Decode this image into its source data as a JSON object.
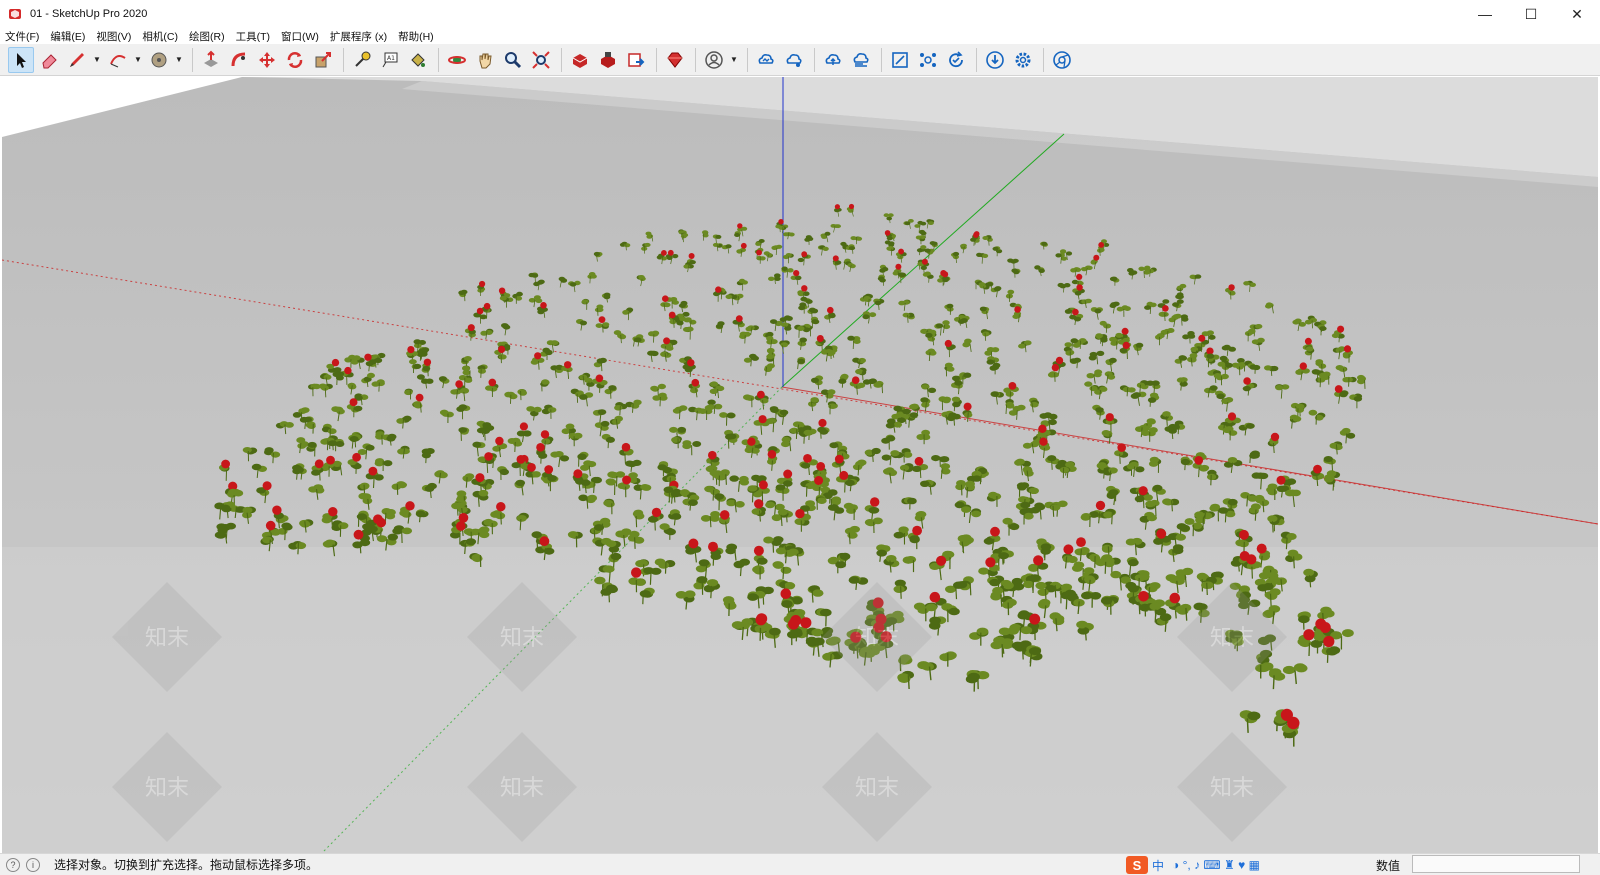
{
  "window": {
    "title": "01 - SketchUp Pro 2020",
    "controls": [
      "—",
      "☐",
      "✕"
    ]
  },
  "menu": [
    "文件(F)",
    "编辑(E)",
    "视图(V)",
    "相机(C)",
    "绘图(R)",
    "工具(T)",
    "窗口(W)",
    "扩展程序 (x)",
    "帮助(H)"
  ],
  "toolbar": {
    "tools": [
      {
        "name": "select-tool-icon",
        "active": true
      },
      {
        "name": "eraser-tool-icon"
      },
      {
        "name": "pencil-line-tool-icon",
        "dropdown": true
      },
      {
        "name": "arc-tool-icon",
        "dropdown": true
      },
      {
        "name": "shape-circle-tool-icon",
        "dropdown": true
      },
      {
        "name": "push-pull-tool-icon"
      },
      {
        "name": "follow-me-tool-icon"
      },
      {
        "name": "move-tool-icon"
      },
      {
        "name": "rotate-tool-icon"
      },
      {
        "name": "scale-tool-icon"
      },
      {
        "name": "tape-measure-tool-icon"
      },
      {
        "name": "text-tool-icon"
      },
      {
        "name": "paint-bucket-tool-icon"
      },
      {
        "name": "orbit-tool-icon"
      },
      {
        "name": "pan-tool-icon"
      },
      {
        "name": "zoom-tool-icon"
      },
      {
        "name": "zoom-extents-tool-icon"
      },
      {
        "name": "3d-warehouse-icon"
      },
      {
        "name": "extension-warehouse-icon"
      },
      {
        "name": "layout-send-icon"
      },
      {
        "name": "extension-manager-ruby-icon"
      },
      {
        "name": "account-user-icon",
        "dropdown": true
      },
      {
        "name": "trimble-connect-icon"
      },
      {
        "name": "cloud-share-icon"
      },
      {
        "name": "cloud-upload-icon"
      },
      {
        "name": "cloud-sync-icon"
      },
      {
        "name": "frame-icon"
      },
      {
        "name": "network-icon"
      },
      {
        "name": "refresh-check-icon"
      },
      {
        "name": "download-icon"
      },
      {
        "name": "settings-gear-icon"
      },
      {
        "name": "chrome-browser-icon"
      }
    ]
  },
  "viewport": {
    "watermark": "知末",
    "colors": {
      "ground_near": "#c9c9c9",
      "ground_far": "#bfbfbf",
      "sky": "#ffffff",
      "axis_red": "#cc2222",
      "axis_green": "#22aa22",
      "axis_blue": "#2233cc",
      "leaf": "#6b8a22",
      "leaf_dark": "#4d6a14",
      "flower": "#c8161a"
    }
  },
  "status": {
    "message": "选择对象。切换到扩充选择。拖动鼠标选择多项。",
    "ime_logo": "S",
    "ime_lang": "中",
    "ime_icons": "◑ °, ♪ ⌨ ♜ ♥ ▦",
    "measure_label": "数值",
    "measure_value": ""
  }
}
